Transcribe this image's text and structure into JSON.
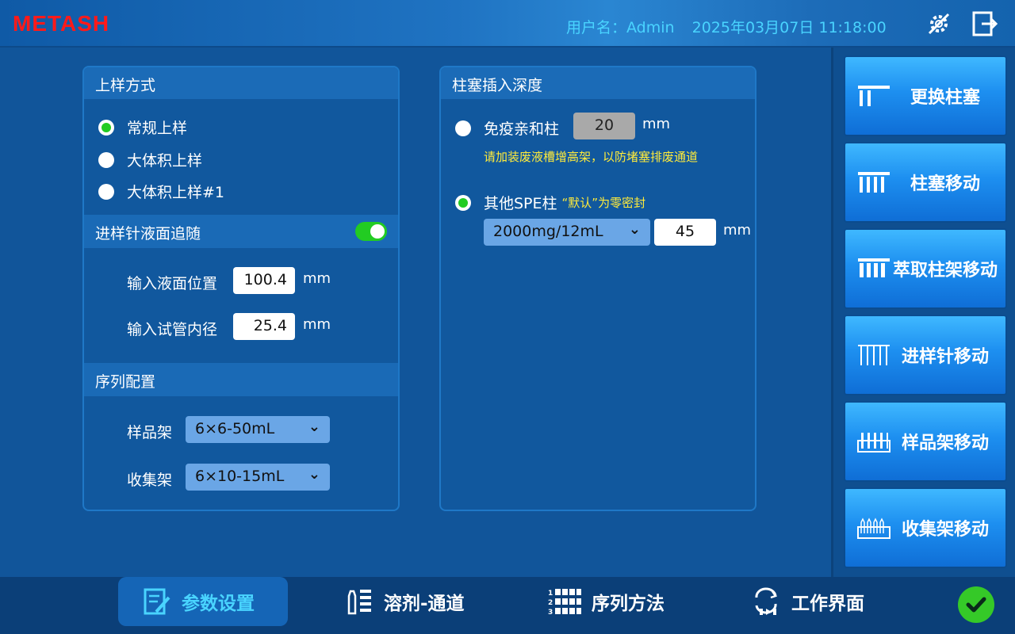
{
  "header": {
    "logo": "METASH",
    "user": "用户名：Admin",
    "datetime": "2025年03月07日 11:18:00"
  },
  "left_panel": {
    "loading_title": "上样方式",
    "loading_options": [
      {
        "label": "常规上样",
        "selected": true
      },
      {
        "label": "大体积上样",
        "selected": false
      },
      {
        "label": "大体积上样#1",
        "selected": false
      }
    ],
    "follow_title": "进样针液面追随",
    "follow_enabled": true,
    "liquid_level_label": "输入液面位置",
    "liquid_level_value": "100.4",
    "liquid_level_unit": "mm",
    "tube_diameter_label": "输入试管内径",
    "tube_diameter_value": "25.4",
    "tube_diameter_unit": "mm",
    "sequence_title": "序列配置",
    "sample_rack_label": "样品架",
    "sample_rack_value": "6×6-50mL",
    "collect_rack_label": "收集架",
    "collect_rack_value": "6×10-15mL"
  },
  "depth_panel": {
    "title": "柱塞插入深度",
    "immuno_label": "免疫亲和柱",
    "immuno_selected": false,
    "immuno_value": "20",
    "immuno_unit": "mm",
    "immuno_hint": "请加装废液槽增高架，以防堵塞排废通道",
    "spe_label": "其他SPE柱",
    "spe_selected": true,
    "spe_hint": "“默认”为零密封",
    "spe_type_value": "2000mg/12mL",
    "spe_depth_value": "45",
    "spe_unit": "mm"
  },
  "sidebar": {
    "buttons": [
      {
        "label": "更换柱塞",
        "icon": "plunger-replace-icon"
      },
      {
        "label": "柱塞移动",
        "icon": "plunger-move-icon"
      },
      {
        "label": "萃取柱架移动",
        "icon": "column-rack-icon"
      },
      {
        "label": "进样针移动",
        "icon": "needle-move-icon"
      },
      {
        "label": "样品架移动",
        "icon": "sample-rack-icon"
      },
      {
        "label": "收集架移动",
        "icon": "collect-rack-icon"
      }
    ]
  },
  "bottom_nav": {
    "tabs": [
      {
        "label": "参数设置",
        "icon": "edit-doc-icon",
        "active": true
      },
      {
        "label": "溶剂-通道",
        "icon": "solvent-bottle-icon",
        "active": false
      },
      {
        "label": "序列方法",
        "icon": "sequence-grid-icon",
        "active": false
      },
      {
        "label": "工作界面",
        "icon": "workflow-icon",
        "active": false
      }
    ]
  },
  "colors": {
    "logo": "#ff1a1a",
    "header_text": "#49d4ff",
    "accent_green": "#22cc22",
    "hint_yellow": "#ffeb3b",
    "button_blue": "#1d8ff0"
  }
}
